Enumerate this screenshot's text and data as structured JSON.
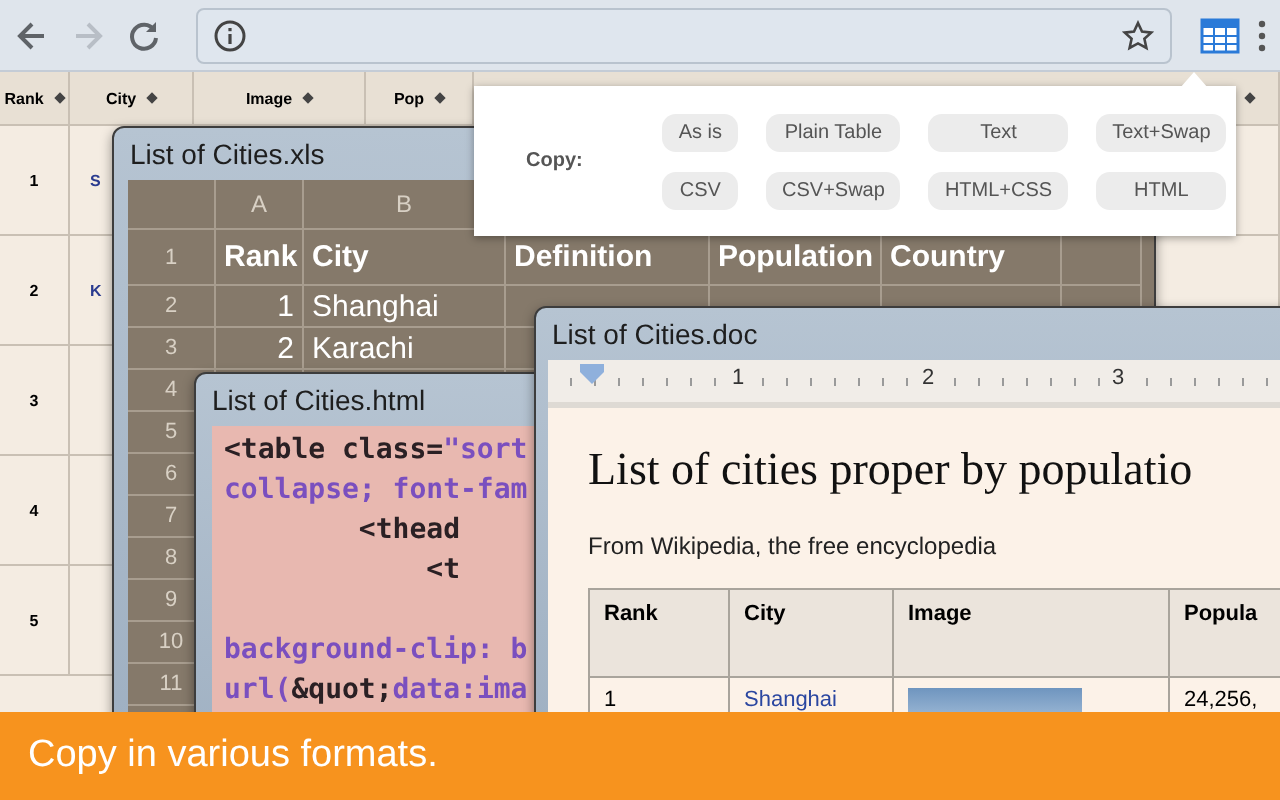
{
  "page_table": {
    "columns": [
      "Rank",
      "City",
      "Image",
      "Pop"
    ],
    "rows": [
      [
        "1",
        "S"
      ],
      [
        "2",
        "K"
      ],
      [
        "3"
      ],
      [
        "4"
      ],
      [
        "5"
      ]
    ]
  },
  "copy_popup": {
    "label": "Copy:",
    "buttons": [
      "As is",
      "Plain Table",
      "Text",
      "Text+Swap",
      "CSV",
      "CSV+Swap",
      "HTML+CSS",
      "HTML"
    ]
  },
  "windows": [
    {
      "kind": "spreadsheet",
      "title": "List of Cities.xls",
      "column_headers": [
        "A",
        "B"
      ],
      "row_numbers": [
        "1",
        "2",
        "3",
        "4",
        "5",
        "6",
        "7",
        "8",
        "9",
        "10",
        "11"
      ],
      "rows": [
        [
          "Rank",
          "City",
          "Definition",
          "Population",
          "Country"
        ],
        [
          "1",
          "Shanghai"
        ],
        [
          "2",
          "Karachi"
        ]
      ]
    },
    {
      "kind": "code",
      "title": "List of Cities.html",
      "lines": [
        {
          "segments": [
            {
              "text": "<table class=",
              "kind": "tag"
            },
            {
              "text": "\"sort",
              "kind": "value"
            }
          ]
        },
        {
          "segments": [
            {
              "text": "collapse; font-fam",
              "kind": "value"
            }
          ]
        },
        {
          "segments": [
            {
              "text": "        <thead",
              "kind": "tag"
            }
          ]
        },
        {
          "segments": [
            {
              "text": "            <t",
              "kind": "tag"
            }
          ]
        },
        {
          "kind": "blank"
        },
        {
          "segments": [
            {
              "text": "background-clip: b",
              "kind": "value"
            }
          ]
        },
        {
          "segments": [
            {
              "text": "url(",
              "kind": "value"
            },
            {
              "text": "&quot;",
              "kind": "tag"
            },
            {
              "text": "data:ima",
              "kind": "value"
            }
          ]
        }
      ]
    },
    {
      "kind": "document",
      "title": "List of Cities.doc",
      "ruler": [
        "1",
        "2",
        "3"
      ],
      "heading": "List of cities proper by populatio",
      "subtitle": "From Wikipedia, the free encyclopedia",
      "table": {
        "columns": [
          "Rank",
          "City",
          "Image",
          "Popula"
        ],
        "rows": [
          [
            {
              "kind": "text",
              "text": "1"
            },
            {
              "kind": "link",
              "text": "Shanghai"
            },
            {
              "kind": "photo"
            },
            {
              "kind": "text",
              "text": "24,256,"
            }
          ]
        ]
      }
    }
  ],
  "banner": "Copy in various formats."
}
